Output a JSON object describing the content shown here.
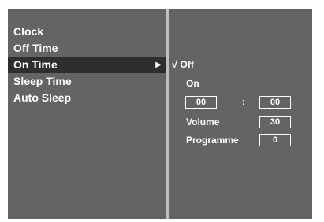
{
  "menu": {
    "items": [
      {
        "label": "Clock"
      },
      {
        "label": "Off Time"
      },
      {
        "label": "On Time"
      },
      {
        "label": "Sleep Time"
      },
      {
        "label": "Auto Sleep"
      }
    ],
    "selected_index": 2,
    "submenu_arrow": "▶"
  },
  "submenu": {
    "check_mark": "√",
    "off_label": "Off",
    "on_label": "On",
    "hour_value": "00",
    "time_separator": ":",
    "minute_value": "00",
    "volume_label": "Volume",
    "volume_value": "30",
    "programme_label": "Programme",
    "programme_value": "0"
  },
  "colors": {
    "background": "#646464",
    "selected": "#2e2e2e",
    "text": "#ffffff",
    "divider": "#bfbfbf"
  }
}
